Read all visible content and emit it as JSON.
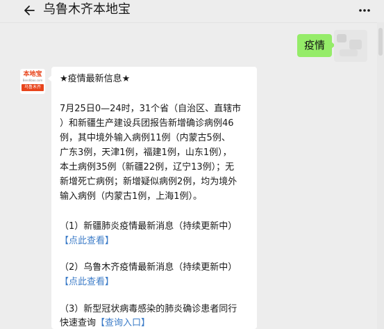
{
  "header": {
    "title": "乌鲁木齐本地宝"
  },
  "sent_message": {
    "text": "疫情"
  },
  "account_avatar": {
    "logo_name": "本地宝",
    "logo_url": "Bendibao.com",
    "logo_city": "乌鲁木齐"
  },
  "received_message": {
    "heading": "★疫情最新信息★",
    "paragraph_lines": [
      "7月25日0—24时，31个省（自治区、直辖市",
      "）和新疆生产建设兵团报告新增确诊病例46",
      "例，其中境外输入病例11例（内蒙古5例、",
      "广东3例，天津1例，福建1例，山东1例），",
      "本土病例35例（新疆22例，辽宁13例）；无",
      "新增死亡病例；新增疑似病例2例，均为境外",
      "输入病例（内蒙古1例，上海1例）。"
    ],
    "item1_text": "（1）新疆肺炎疫情最新消息（持续更新中）",
    "item1_link": "【点此查看】",
    "item2_text": "（2）乌鲁木齐疫情最新消息（持续更新中）",
    "item2_link": "【点此查看】",
    "item3_text": "（3）新型冠状病毒感染的肺炎确诊患者同行",
    "item3_text_cont": "快速查询",
    "item3_link": "【查询入口】"
  },
  "colors": {
    "background": "#ededed",
    "sent_bubble": "#95ec69",
    "link": "#3c7cc8",
    "brand_red": "#e8441b"
  },
  "icons": {
    "back": "back-arrow-icon",
    "more": "more-dots-icon"
  }
}
